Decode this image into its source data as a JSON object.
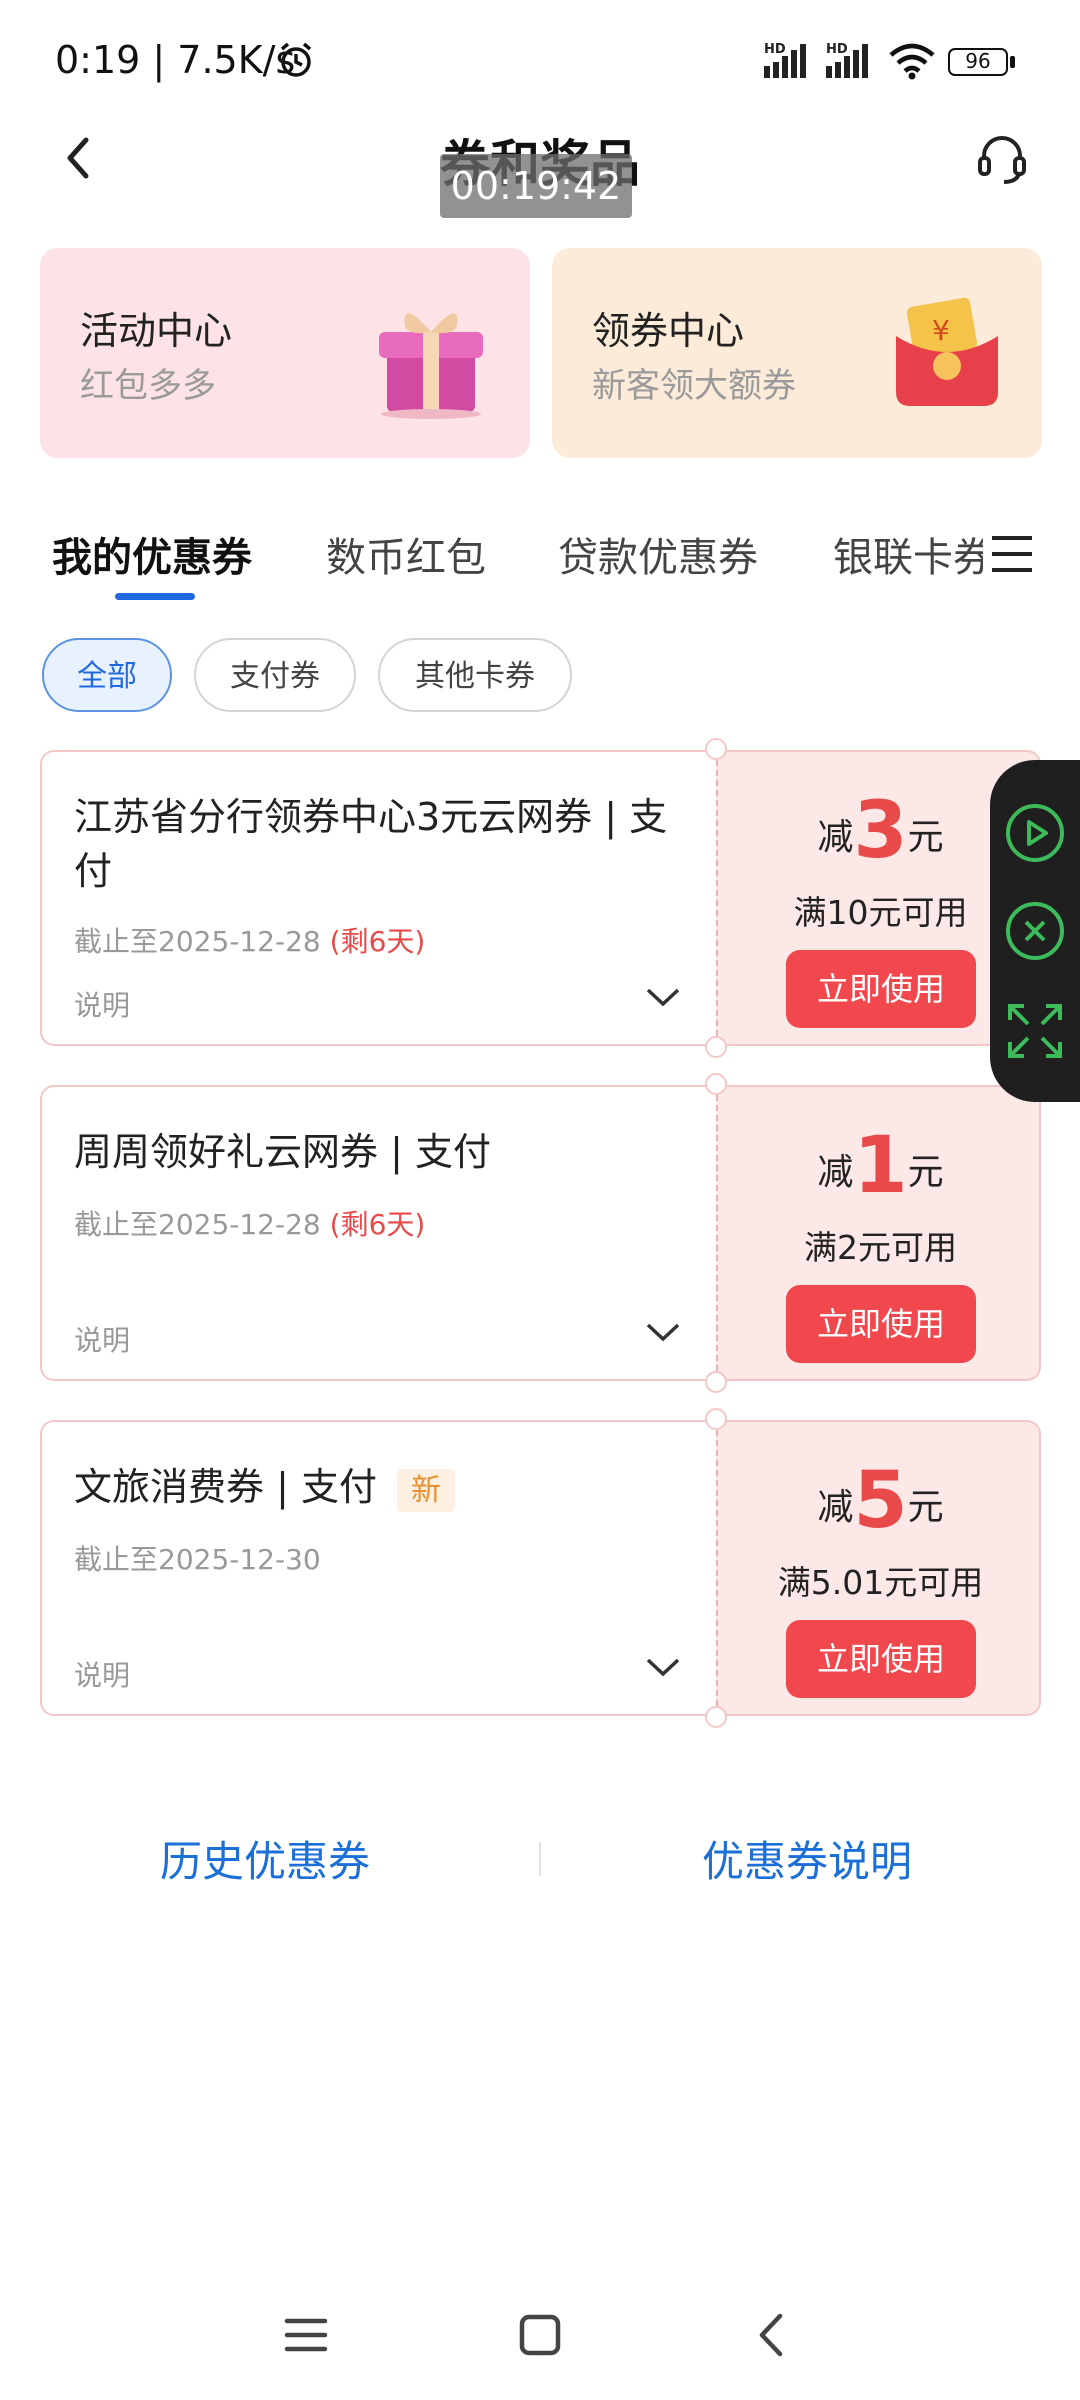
{
  "status_bar": {
    "time": "0:19 | 7.5K/s",
    "signal_label": "HD",
    "battery": "96"
  },
  "header": {
    "title": "券和奖品",
    "timer": "00:19:42"
  },
  "banners": [
    {
      "title": "活动中心",
      "subtitle": "红包多多",
      "icon": "gift-box-icon"
    },
    {
      "title": "领券中心",
      "subtitle": "新客领大额券",
      "icon": "red-envelope-icon"
    }
  ],
  "tabs": [
    "我的优惠券",
    "数币红包",
    "贷款优惠券",
    "银联卡券"
  ],
  "filters": [
    "全部",
    "支付券",
    "其他卡券"
  ],
  "coupons": [
    {
      "title": "江苏省分行领券中心3元云网券 | 支付",
      "date": "截止至2025-12-28",
      "remain": "(剩6天)",
      "desc": "说明",
      "prefix": "减",
      "amount": "3",
      "unit": "元",
      "condition": "满10元可用",
      "button": "立即使用"
    },
    {
      "title": "周周领好礼云网券 | 支付",
      "date": "截止至2025-12-28",
      "remain": "(剩6天)",
      "desc": "说明",
      "prefix": "减",
      "amount": "1",
      "unit": "元",
      "condition": "满2元可用",
      "button": "立即使用"
    },
    {
      "title": "文旅消费券 | 支付",
      "tag": "新",
      "date": "截止至2025-12-30",
      "desc": "说明",
      "prefix": "减",
      "amount": "5",
      "unit": "元",
      "condition": "满5.01元可用",
      "button": "立即使用"
    }
  ],
  "footer": {
    "history": "历史优惠券",
    "instructions": "优惠券说明"
  },
  "colors": {
    "accent": "#1f6ae0",
    "coupon_red": "#e84a4a",
    "button_red": "#f1484e",
    "link_blue": "#1a6fd8"
  }
}
